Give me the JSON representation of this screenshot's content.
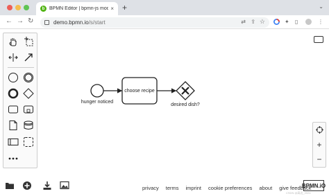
{
  "browser": {
    "tab_title": "BPMN Editor | bpmn-js model",
    "url_host": "demo.bpmn.io",
    "url_path": "/s/start",
    "new_tab_symbol": "+",
    "tab_close_symbol": "×"
  },
  "diagram": {
    "start_event_label": "hunger noticed",
    "task_label": "choose recipe",
    "gateway_label": "desired dish?"
  },
  "footer": {
    "links": [
      "privacy",
      "terms",
      "imprint",
      "cookie preferences",
      "about",
      "give feedback"
    ],
    "logo": "BPMN.iO",
    "watermark": "CSDN @高达_2024"
  },
  "colors": {
    "accent": "#52b415"
  }
}
